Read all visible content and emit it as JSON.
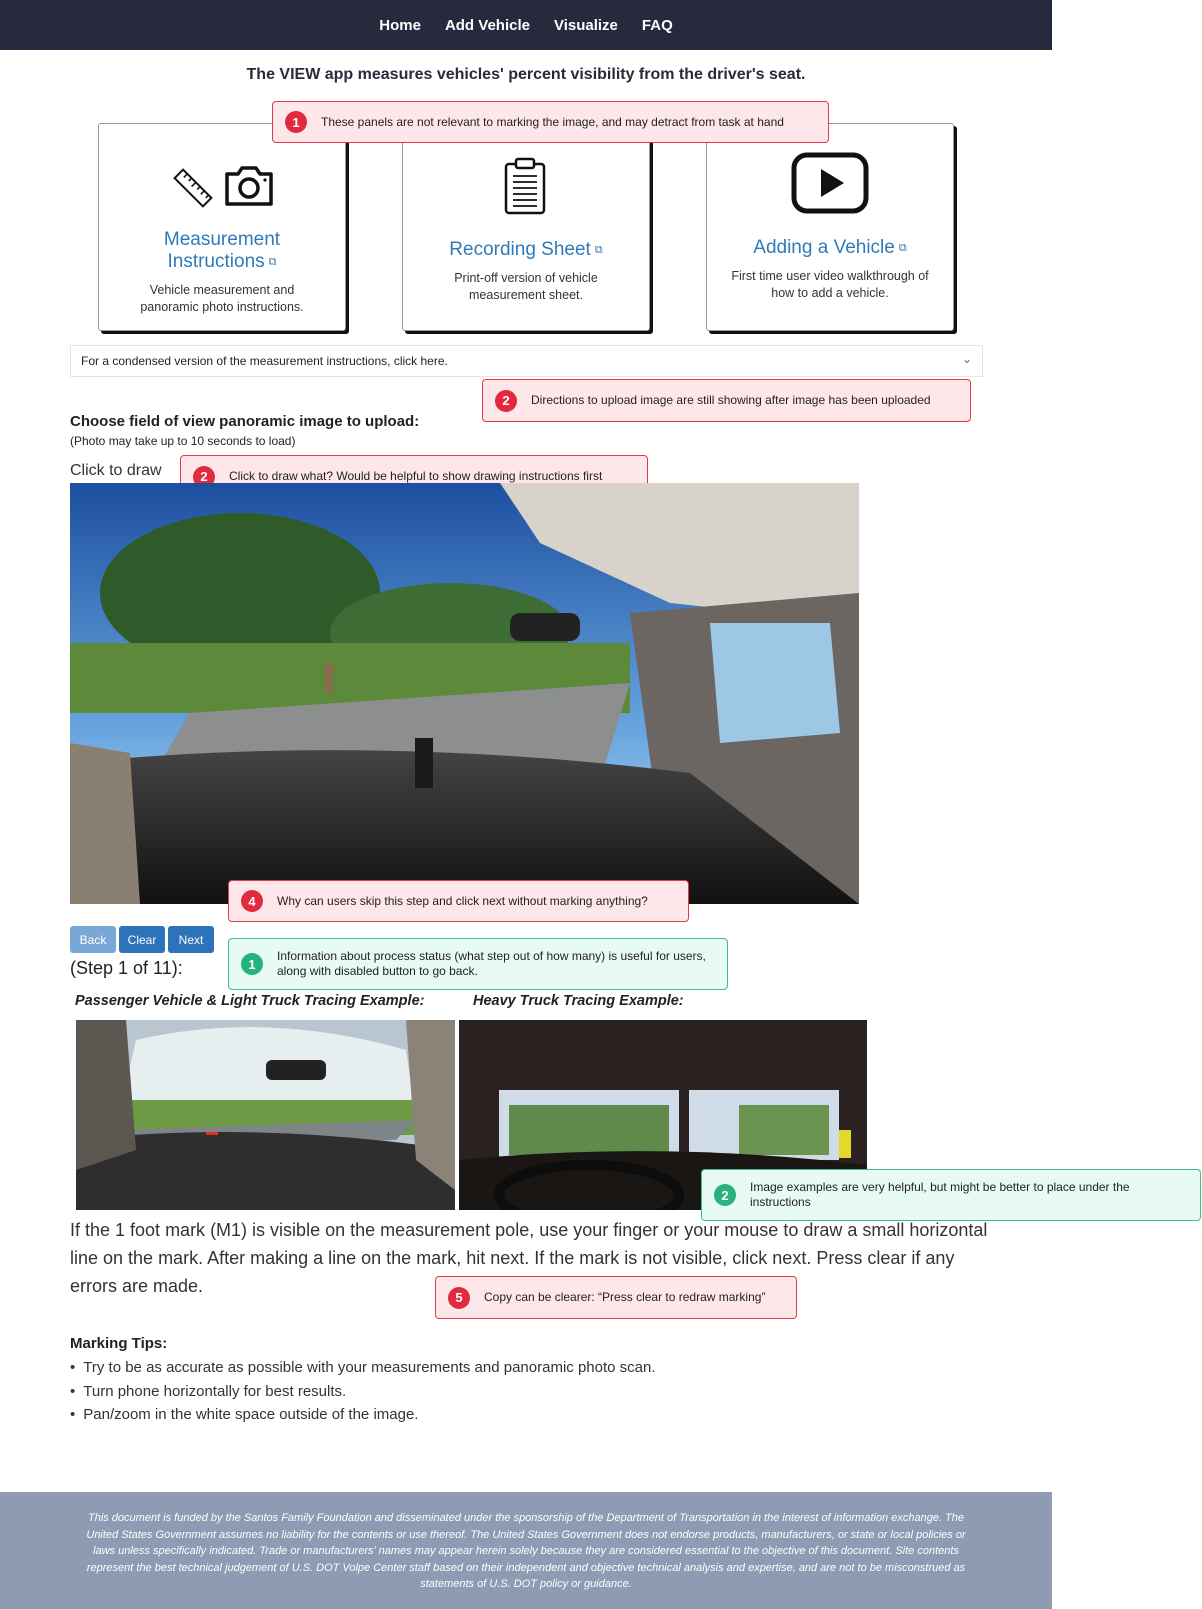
{
  "nav": {
    "items": [
      "Home",
      "Add Vehicle",
      "Visualize",
      "FAQ"
    ]
  },
  "tagline": "The VIEW app measures vehicles' percent visibility from the driver's seat.",
  "cards": [
    {
      "title_line1": "Measurement",
      "title_line2": "Instructions",
      "desc_line1": "Vehicle measurement and",
      "desc_line2": "panoramic photo instructions.",
      "icons": [
        "ruler-icon",
        "camera-icon",
        "external-link-icon"
      ]
    },
    {
      "title": "Recording Sheet",
      "desc_line1": "Print-off version of vehicle",
      "desc_line2": "measurement sheet.",
      "icons": [
        "clipboard-icon",
        "external-link-icon"
      ]
    },
    {
      "title": "Adding a Vehicle",
      "desc_line1": "First time user video walkthrough of",
      "desc_line2": "how to add a vehicle.",
      "icons": [
        "play-icon",
        "external-link-icon"
      ]
    }
  ],
  "accordion": {
    "label": "For a condensed version of the measurement instructions, click here.",
    "icon": "chevron-down-icon"
  },
  "upload": {
    "heading": "Choose field of view panoramic image to upload:",
    "note": "(Photo may take up to 10 seconds to load)",
    "click_to_draw": "Click to draw"
  },
  "buttons": {
    "back": "Back",
    "clear": "Clear",
    "next": "Next"
  },
  "step": "(Step 1 of 11):",
  "examples": {
    "passenger_label": "Passenger Vehicle & Light Truck Tracing Example:",
    "heavy_label": "Heavy Truck Tracing Example:"
  },
  "instructions": "If the 1 foot mark (M1) is visible on the measurement pole, use your finger or your mouse to draw a small horizontal line on the mark. After making a line on the mark, hit next. If the mark is not visible, click next. Press clear if any errors are made.",
  "tips": {
    "heading": "Marking Tips:",
    "items": [
      "Try to be as accurate as possible with your measurements and panoramic photo scan.",
      "Turn phone horizontally for best results.",
      "Pan/zoom in the white space outside of the image."
    ]
  },
  "annotations": [
    {
      "num": "1",
      "type": "issue",
      "color": "#e12a3d",
      "text": "These panels are not relevant to marking the image, and may detract from task at hand"
    },
    {
      "num": "2",
      "type": "issue",
      "color": "#e12a3d",
      "text": "Directions to upload image are still showing after image has been uploaded"
    },
    {
      "num": "2",
      "type": "issue",
      "color": "#e12a3d",
      "text": "Click to draw what? Would be helpful to show drawing instructions first"
    },
    {
      "num": "4",
      "type": "issue",
      "color": "#e12a3d",
      "text": "Why can users skip this step and click next without marking anything?"
    },
    {
      "num": "1",
      "type": "positive",
      "color": "#26b37d",
      "text": "Information about process status (what step out of how many) is useful for users, along with disabled button to go back."
    },
    {
      "num": "2",
      "type": "positive",
      "color": "#26b37d",
      "text": "Image examples are very helpful, but might be better to place under the instructions"
    },
    {
      "num": "5",
      "type": "issue",
      "color": "#e12a3d",
      "text": "Copy can be clearer: “Press clear to redraw marking”"
    }
  ],
  "footer": "This document is funded by the Santos Family Foundation and disseminated under the sponsorship of the Department of Transportation in the interest of information exchange. The United States Government assumes no liability for the contents or use thereof. The United States Government does not endorse products, manufacturers, or state or local policies or laws unless specifically indicated. Trade or manufacturers' names may appear herein solely because they are considered essential to the objective of this document. Site contents represent the best technical judgement of U.S. DOT Volpe Center staff based on their independent and objective technical analysis and expertise, and are not to be misconstrued as statements of U.S. DOT policy or guidance."
}
